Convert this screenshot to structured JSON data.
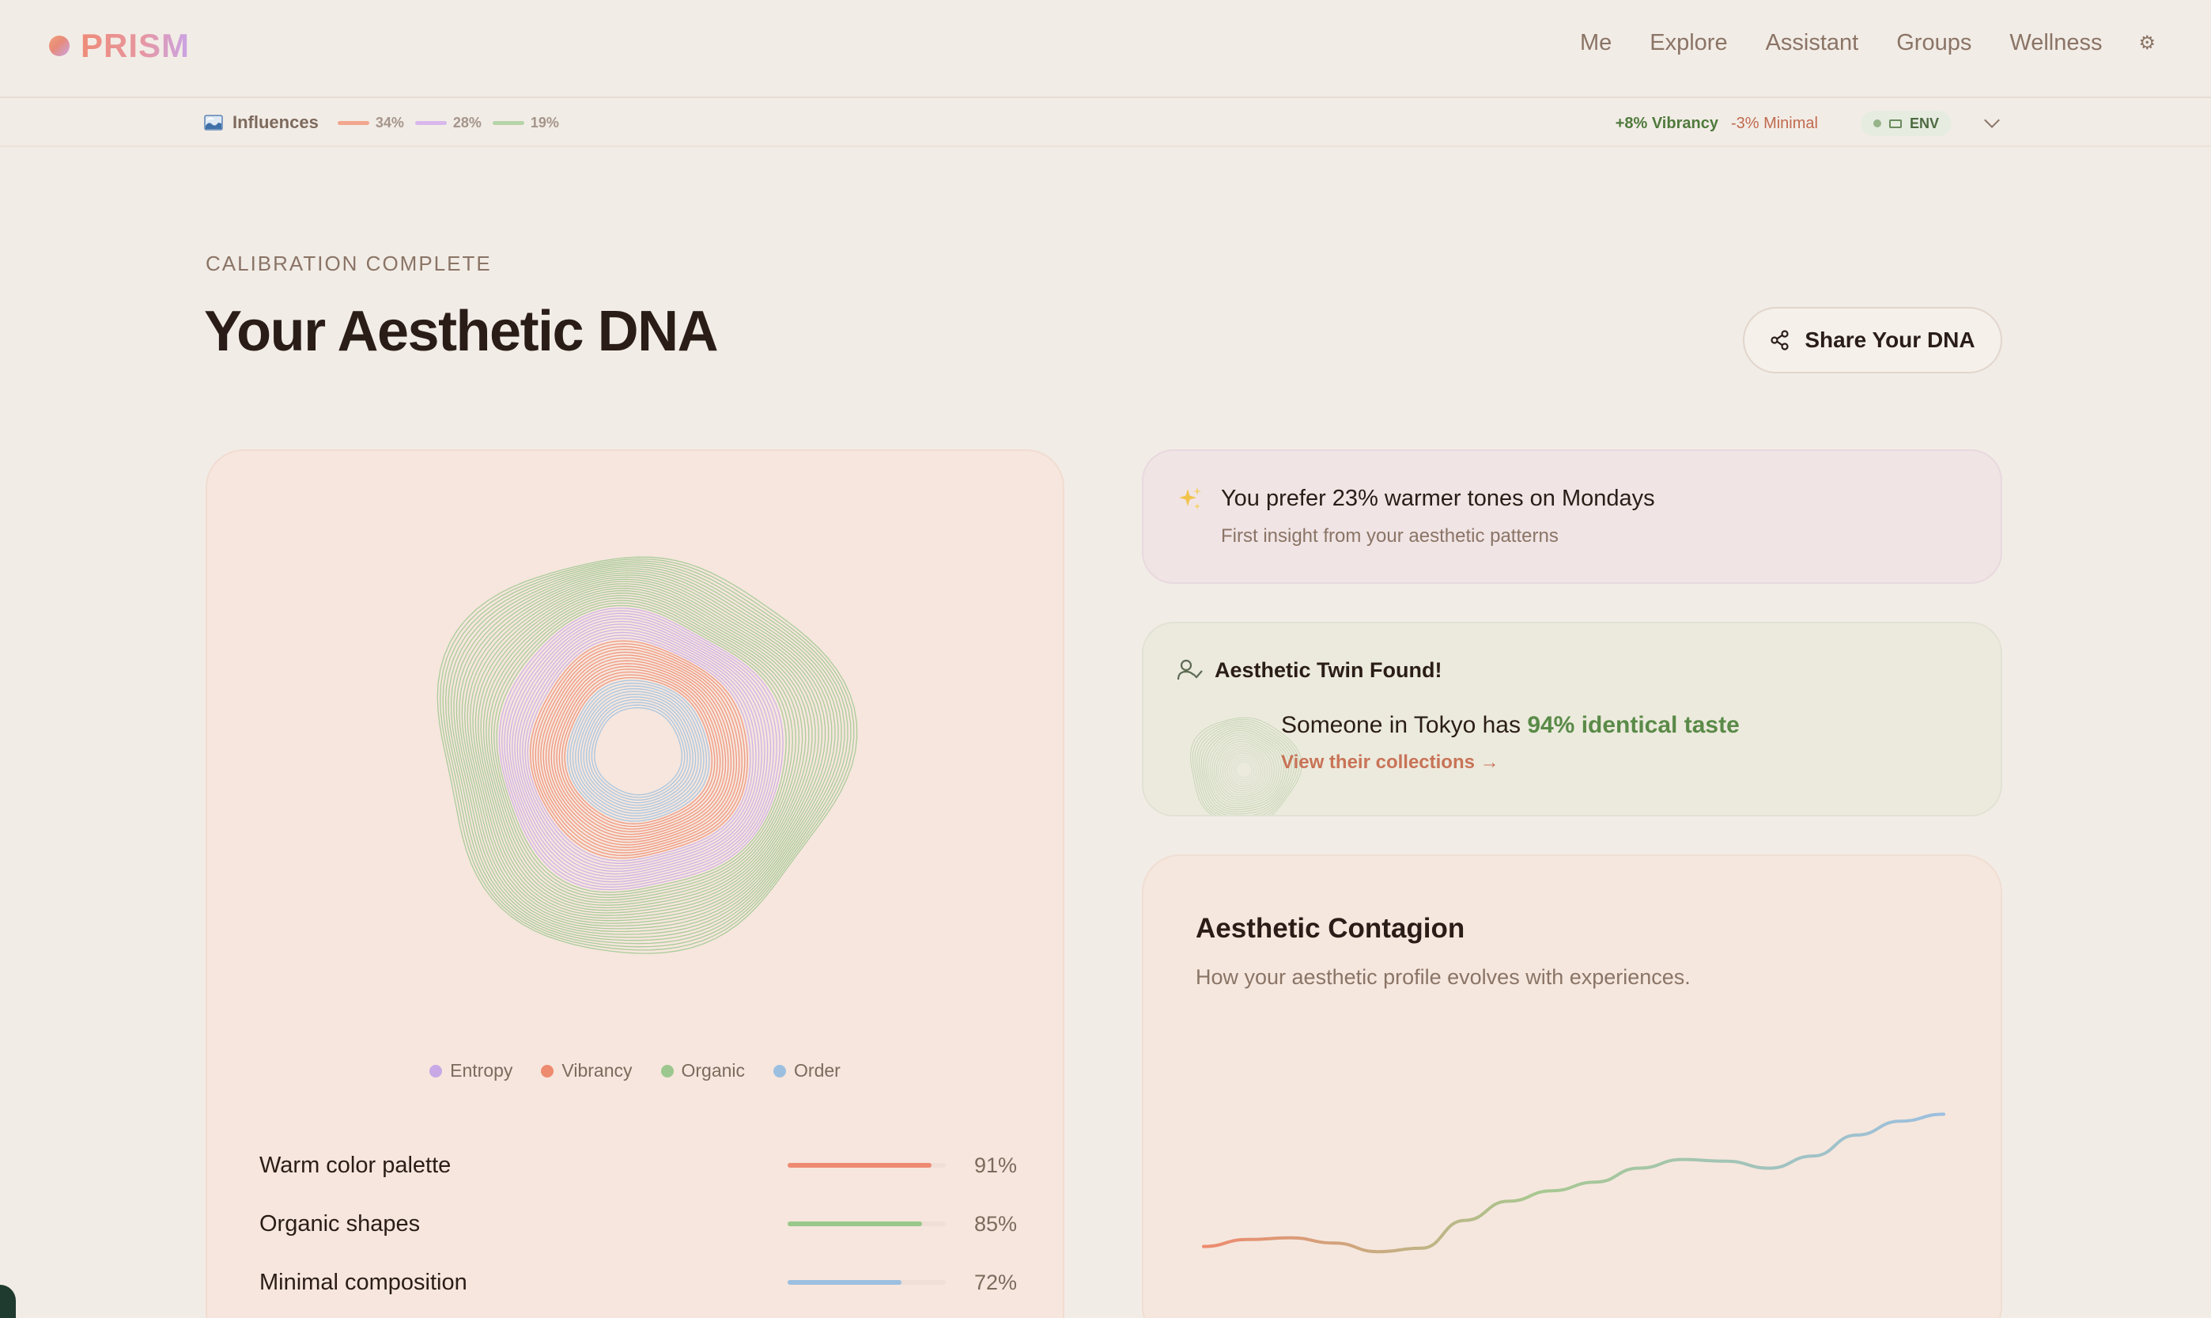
{
  "app": {
    "name": "PRISM"
  },
  "nav": {
    "items": [
      "Me",
      "Explore",
      "Assistant",
      "Groups",
      "Wellness"
    ],
    "settings_icon": "gear-icon",
    "settings_glyph": "⚙"
  },
  "influences": {
    "label": "Influences",
    "items": [
      {
        "pct": "34%",
        "color": "#f2a78e"
      },
      {
        "pct": "28%",
        "color": "#d8b8ec"
      },
      {
        "pct": "19%",
        "color": "#b6d4a8"
      }
    ],
    "delta_positive": "+8% Vibrancy",
    "delta_negative": "-3% Minimal",
    "env_label": "ENV"
  },
  "hero": {
    "eyebrow": "CALIBRATION COMPLETE",
    "title": "Your Aesthetic DNA",
    "share_label": "Share Your DNA"
  },
  "dna": {
    "legend": [
      {
        "label": "Entropy",
        "color": "#c9a8e6"
      },
      {
        "label": "Vibrancy",
        "color": "#ee8a6e"
      },
      {
        "label": "Organic",
        "color": "#9cc78e"
      },
      {
        "label": "Order",
        "color": "#9cbfe0"
      }
    ],
    "traits": [
      {
        "label": "Warm color palette",
        "value": 91,
        "pct": "91%",
        "color": "#ef8a72"
      },
      {
        "label": "Organic shapes",
        "value": 85,
        "pct": "85%",
        "color": "#98c88a"
      },
      {
        "label": "Minimal composition",
        "value": 72,
        "pct": "72%",
        "color": "#9cbfe0"
      }
    ]
  },
  "insight": {
    "title": "You prefer 23% warmer tones on Mondays",
    "subtitle": "First insight from your aesthetic patterns"
  },
  "twin": {
    "heading": "Aesthetic Twin Found!",
    "line_prefix": "Someone in Tokyo has ",
    "line_highlight": "94% identical taste",
    "link": "View their collections →"
  },
  "contagion": {
    "title": "Aesthetic Contagion",
    "subtitle": "How your aesthetic profile evolves with experiences.",
    "trend": [
      0.12,
      0.16,
      0.17,
      0.14,
      0.09,
      0.11,
      0.27,
      0.38,
      0.44,
      0.49,
      0.57,
      0.62,
      0.61,
      0.57,
      0.64,
      0.76,
      0.84,
      0.88
    ],
    "color_start": "#ee8a6e",
    "color_mid": "#a8c890",
    "color_end": "#9cbfe0"
  }
}
